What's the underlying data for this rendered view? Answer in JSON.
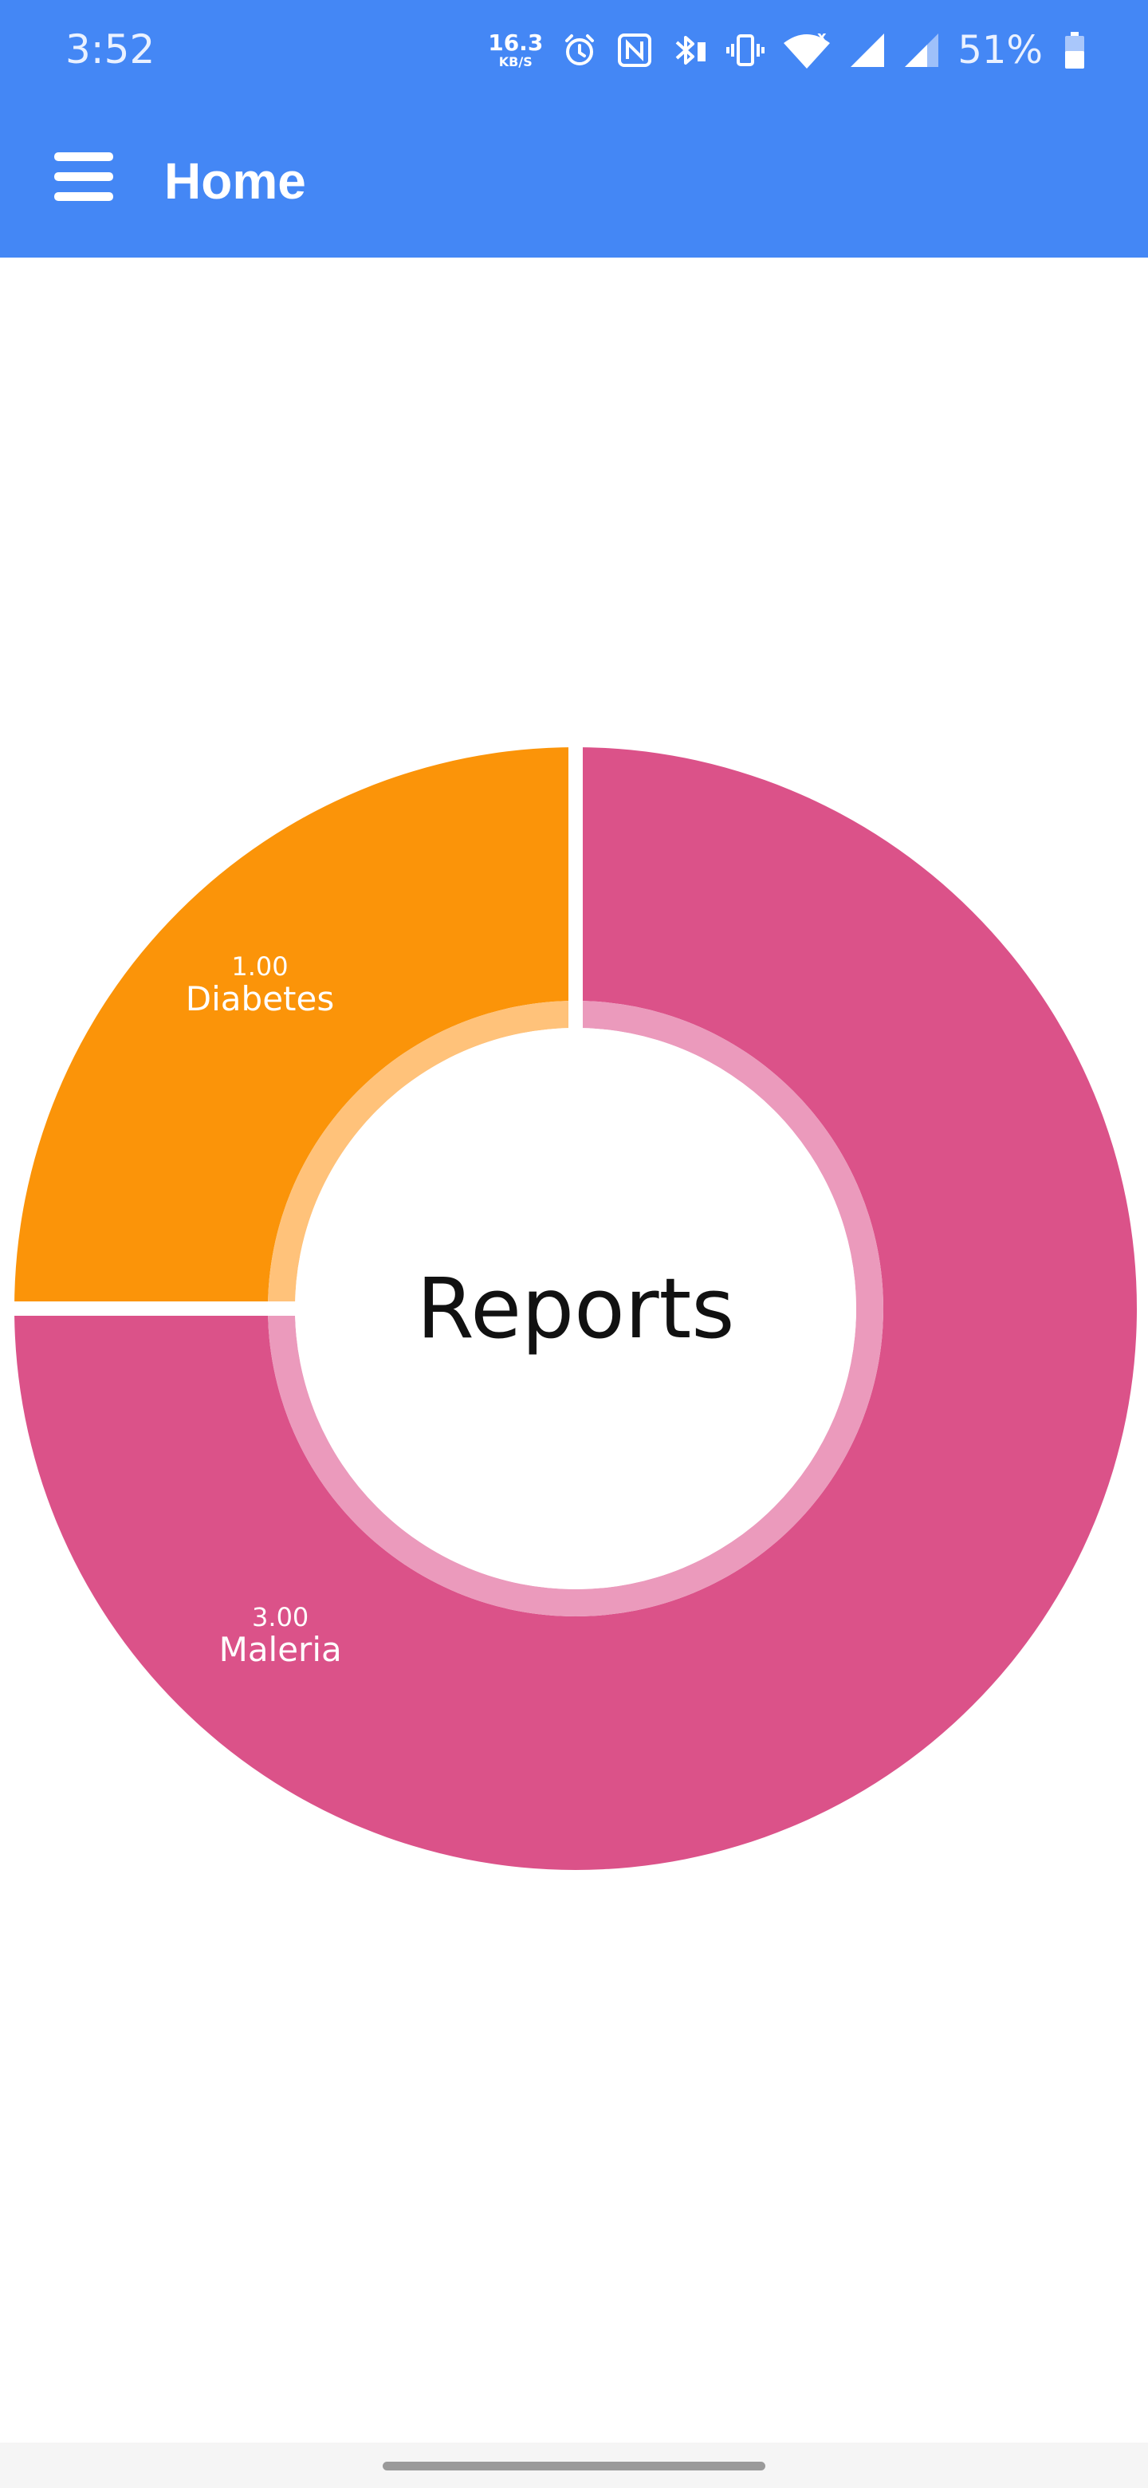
{
  "status_bar": {
    "time": "3:52",
    "net_speed_value": "16.3",
    "net_speed_unit": "KB/S",
    "battery_percent": "51%",
    "icons": [
      "alarm-icon",
      "nfc-icon",
      "bluetooth-battery-icon",
      "vibrate-icon",
      "wifi-icon",
      "signal-icon",
      "signal-icon-2",
      "battery-icon"
    ]
  },
  "app_bar": {
    "menu_icon": "hamburger-menu-icon",
    "title": "Home",
    "background_color": "#4487f5"
  },
  "chart_data": {
    "type": "pie",
    "style": "donut",
    "center_label": "Reports",
    "slices": [
      {
        "label": "Maleria",
        "value": 3.0,
        "value_label": "3.00",
        "color": "#db5289",
        "inner_color": "#eb9abc"
      },
      {
        "label": "Diabetes",
        "value": 1.0,
        "value_label": "1.00",
        "color": "#fb9409",
        "inner_color": "#ffc27a"
      }
    ]
  }
}
